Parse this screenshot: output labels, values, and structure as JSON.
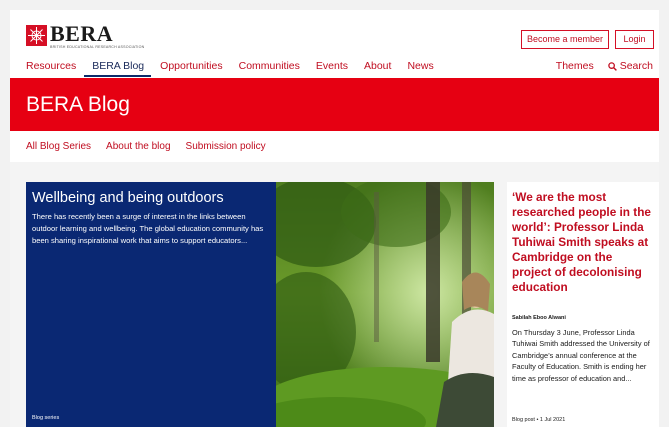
{
  "header": {
    "logo_word": "BERA",
    "logo_sub": "BRITISH EDUCATIONAL RESEARCH ASSOCIATION",
    "become_member": "Become a member",
    "login": "Login"
  },
  "nav": {
    "items": [
      "Resources",
      "BERA Blog",
      "Opportunities",
      "Communities",
      "Events",
      "About",
      "News"
    ],
    "themes": "Themes",
    "search": "Search"
  },
  "banner": {
    "title": "BERA Blog"
  },
  "subnav": {
    "items": [
      "All Blog Series",
      "About the blog",
      "Submission policy"
    ]
  },
  "feature": {
    "title": "Wellbeing and being outdoors",
    "description": "There has recently been a surge of interest in the links between outdoor learning and wellbeing. The global education community has been sharing inspirational work that aims to support educators...",
    "tag": "Blog series"
  },
  "side_article": {
    "title": "‘We are the most researched people in the world’: Professor Linda Tuhiwai Smith speaks at Cambridge on the project of decolonising education",
    "author": "Sabilah Eboo Alwani",
    "body": "On Thursday 3 June, Professor Linda Tuhiwai Smith addressed the University of Cambridge’s annual conference at the Faculty of Education. Smith is ending her time as professor of education and...",
    "meta": "Blog post  •  1 Jul 2021"
  },
  "colors": {
    "brand_red": "#e60012",
    "link_red": "#c00d20",
    "navy": "#0a2873"
  }
}
